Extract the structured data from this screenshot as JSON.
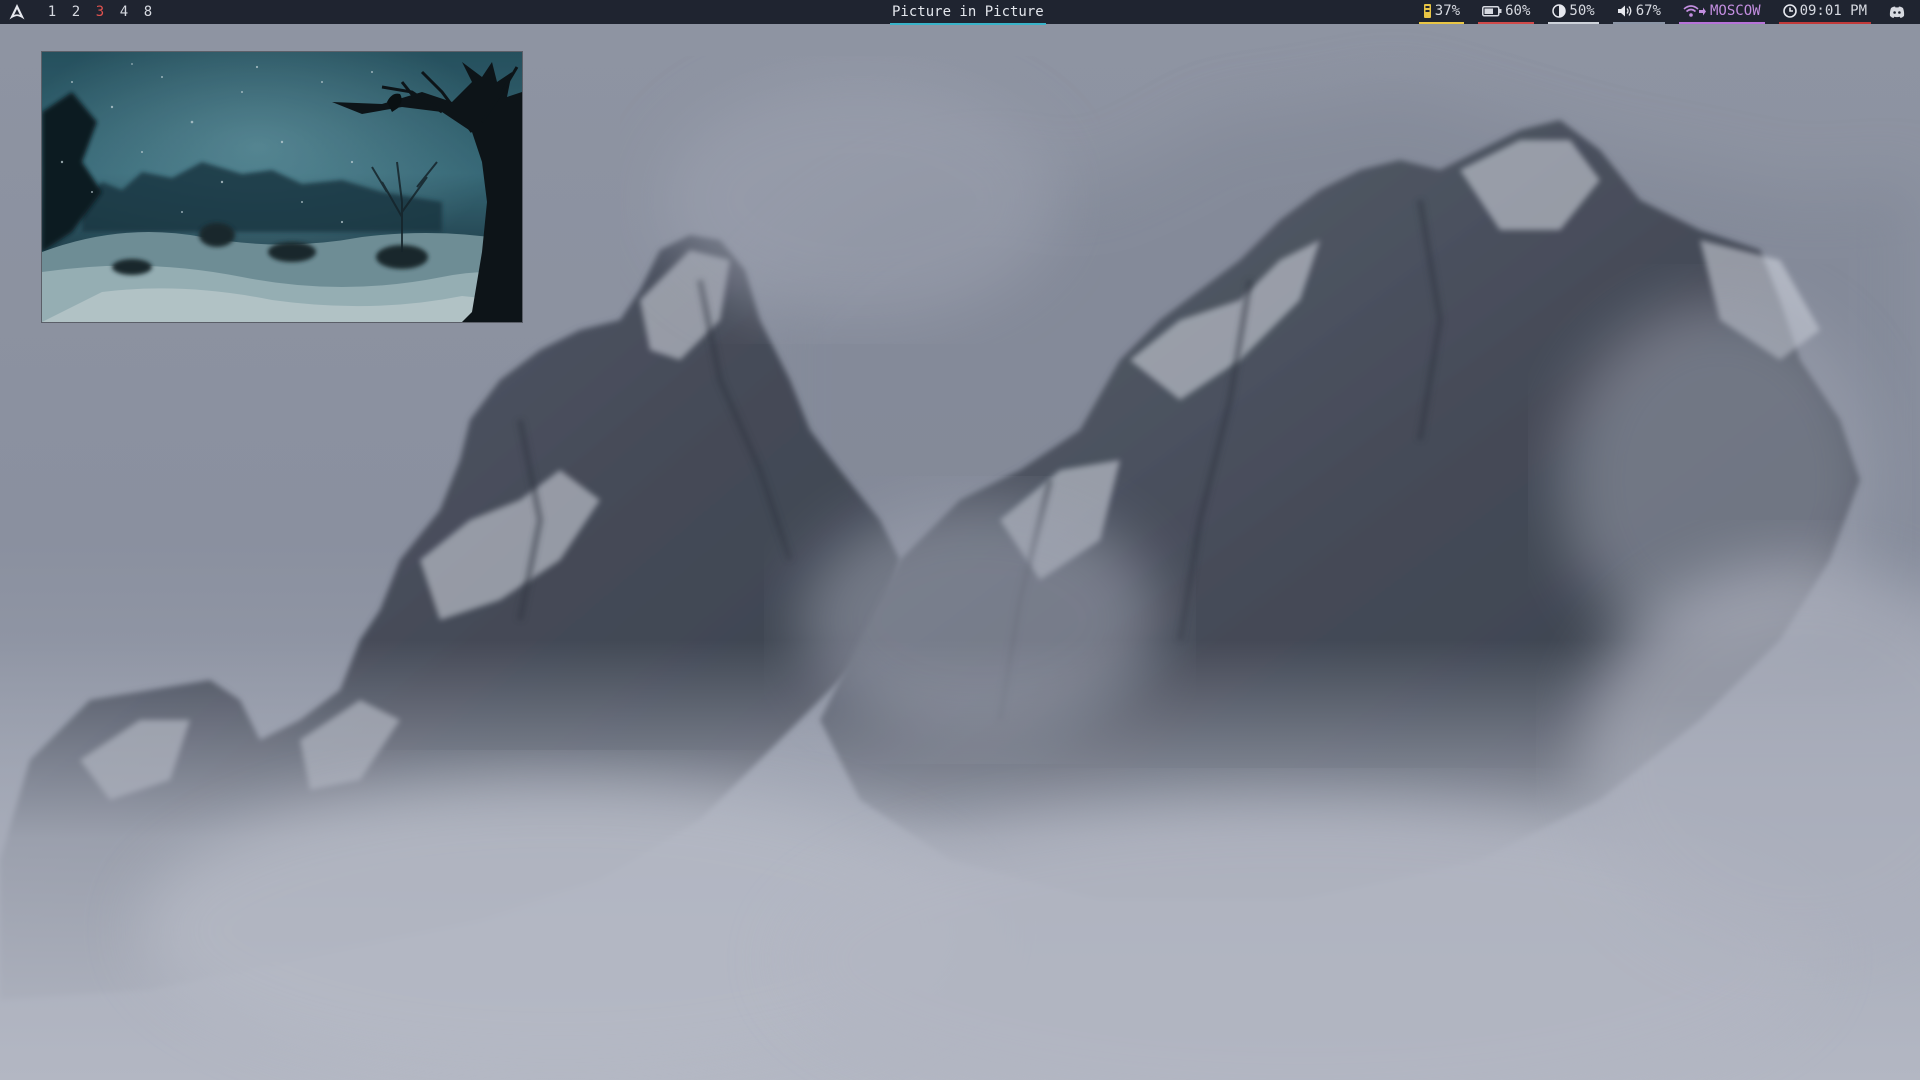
{
  "bar": {
    "workspaces": [
      {
        "label": "1",
        "active": false
      },
      {
        "label": "2",
        "active": false
      },
      {
        "label": "3",
        "active": true
      },
      {
        "label": "4",
        "active": false
      },
      {
        "label": "8",
        "active": false
      }
    ],
    "window_title": "Picture in Picture",
    "modules": {
      "memory": {
        "icon": "memory-icon",
        "value": "37%"
      },
      "battery": {
        "icon": "battery-icon",
        "value": "60%"
      },
      "brightness": {
        "icon": "brightness-icon",
        "value": "50%"
      },
      "volume": {
        "icon": "volume-icon",
        "value": "67%"
      },
      "network": {
        "icon": "wifi-icon",
        "value": "MOSCOW"
      },
      "clock": {
        "icon": "clock-icon",
        "value": "09:01 PM"
      },
      "tray": {
        "icon": "discord-tray-icon"
      }
    }
  },
  "colors": {
    "bar_background": "#1f2430",
    "active_workspace": "#e0524f",
    "title_underline": "#39b3c9",
    "memory_accent": "#e8c545",
    "battery_accent": "#d04a4a",
    "network_accent": "#b673d8"
  },
  "pip_window": {
    "content": "video-frame"
  }
}
